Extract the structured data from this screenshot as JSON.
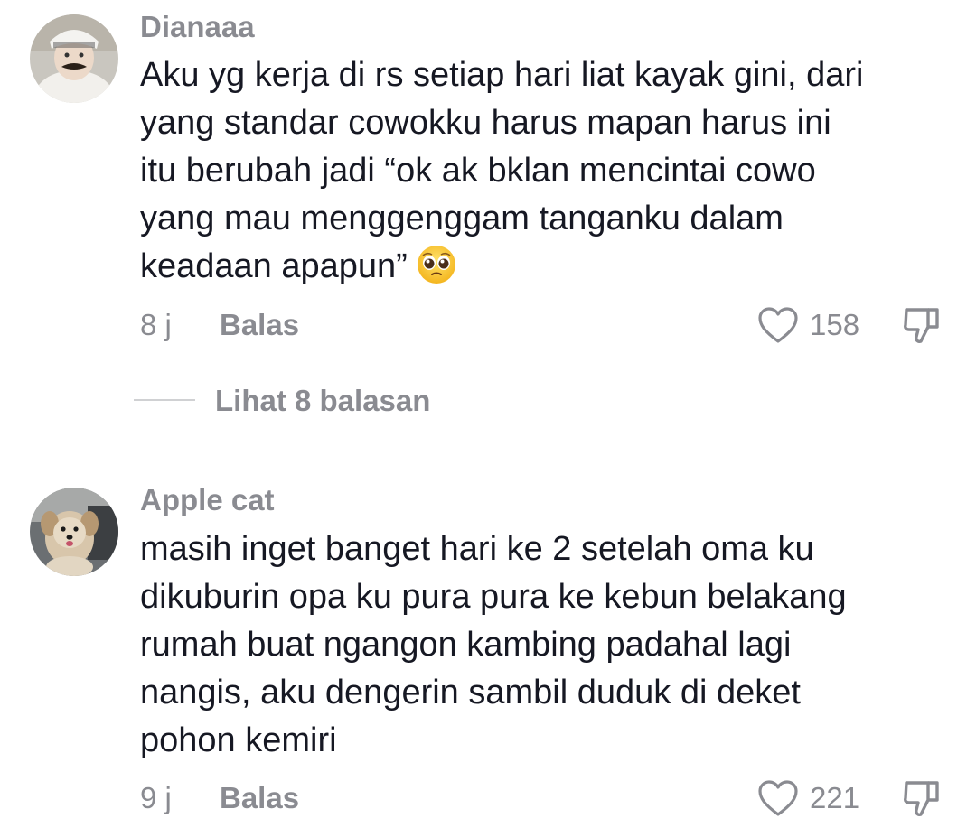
{
  "comments": [
    {
      "username": "Dianaaa",
      "lines": [
        "Aku yg kerja di rs setiap hari liat kayak gini, dari",
        "yang standar cowokku harus mapan harus ini",
        "itu berubah jadi “ok ak bklan mencintai cowo",
        "yang mau menggenggam tanganku dalam",
        "keadaan apapun”"
      ],
      "emoji": "pleading-face-emoji",
      "time": "8 j",
      "reply_label": "Balas",
      "likes": "158",
      "view_replies": "Lihat 8 balasan"
    },
    {
      "username": "Apple cat",
      "lines": [
        "masih inget banget hari ke 2 setelah oma ku",
        "dikuburin opa ku pura pura ke kebun belakang",
        "rumah buat ngangon kambing padahal lagi",
        "nangis, aku dengerin sambil duduk di deket",
        "pohon kemiri"
      ],
      "time": "9 j",
      "reply_label": "Balas",
      "likes": "221"
    }
  ],
  "icons": {
    "like": "heart-outline-icon",
    "dislike": "thumbs-down-outline-icon"
  },
  "colors": {
    "text": "#161823",
    "muted": "#8a8b91",
    "divider": "#d0d1d3",
    "background": "#ffffff"
  }
}
